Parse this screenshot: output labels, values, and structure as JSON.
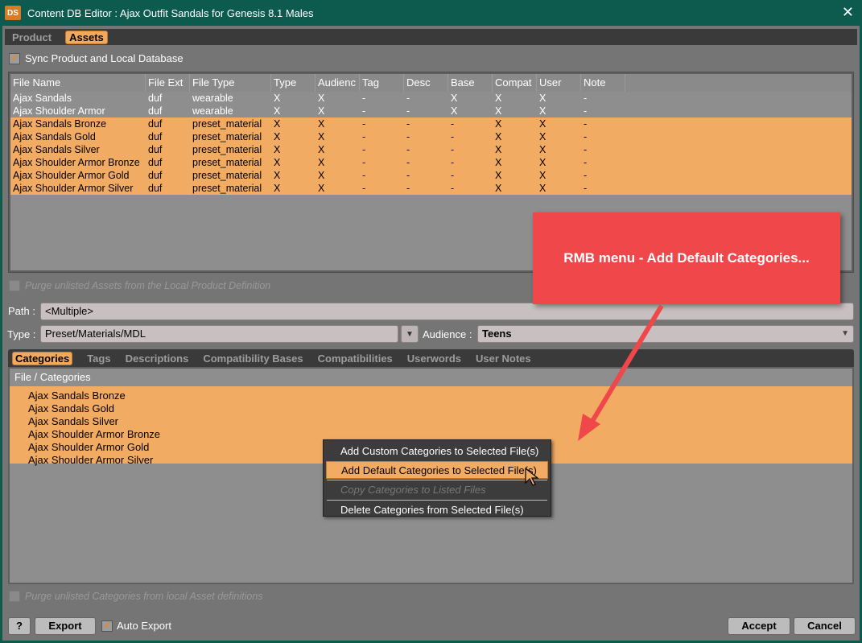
{
  "window": {
    "title": "Content DB Editor : Ajax Outfit Sandals for Genesis 8.1 Males",
    "logo": "DS",
    "close": "✕"
  },
  "top_tabs": [
    {
      "label": "Product"
    },
    {
      "label": "Assets"
    }
  ],
  "sync": {
    "label": "Sync Product and Local Database",
    "checked": true
  },
  "asset_table": {
    "columns": [
      "File Name",
      "File Ext",
      "File Type",
      "Type",
      "Audienc",
      "Tag",
      "Desc",
      "Base",
      "Compat",
      "User",
      "Note"
    ],
    "rows": [
      {
        "selected": false,
        "cells": [
          "Ajax Sandals",
          "duf",
          "wearable",
          "X",
          "X",
          "-",
          "-",
          "X",
          "X",
          "X",
          "-"
        ]
      },
      {
        "selected": false,
        "cells": [
          "Ajax Shoulder Armor",
          "duf",
          "wearable",
          "X",
          "X",
          "-",
          "-",
          "X",
          "X",
          "X",
          "-"
        ]
      },
      {
        "selected": true,
        "cells": [
          "Ajax Sandals Bronze",
          "duf",
          "preset_material",
          "X",
          "X",
          "-",
          "-",
          "-",
          "X",
          "X",
          "-"
        ]
      },
      {
        "selected": true,
        "cells": [
          "Ajax Sandals Gold",
          "duf",
          "preset_material",
          "X",
          "X",
          "-",
          "-",
          "-",
          "X",
          "X",
          "-"
        ]
      },
      {
        "selected": true,
        "cells": [
          "Ajax Sandals Silver",
          "duf",
          "preset_material",
          "X",
          "X",
          "-",
          "-",
          "-",
          "X",
          "X",
          "-"
        ]
      },
      {
        "selected": true,
        "cells": [
          "Ajax Shoulder Armor Bronze",
          "duf",
          "preset_material",
          "X",
          "X",
          "-",
          "-",
          "-",
          "X",
          "X",
          "-"
        ]
      },
      {
        "selected": true,
        "cells": [
          "Ajax Shoulder Armor Gold",
          "duf",
          "preset_material",
          "X",
          "X",
          "-",
          "-",
          "-",
          "X",
          "X",
          "-"
        ]
      },
      {
        "selected": true,
        "cells": [
          "Ajax Shoulder Armor Silver",
          "duf",
          "preset_material",
          "X",
          "X",
          "-",
          "-",
          "-",
          "X",
          "X",
          "-"
        ]
      }
    ]
  },
  "purge_assets": {
    "label": "Purge unlisted Assets from the Local Product Definition",
    "enabled": false
  },
  "path": {
    "label": "Path :",
    "value": "<Multiple>"
  },
  "type": {
    "label": "Type :",
    "value": "Preset/Materials/MDL"
  },
  "audience": {
    "label": "Audience :",
    "value": "Teens"
  },
  "bottom_tabs": [
    {
      "label": "Categories"
    },
    {
      "label": "Tags"
    },
    {
      "label": "Descriptions"
    },
    {
      "label": "Compatibility Bases"
    },
    {
      "label": "Compatibilities"
    },
    {
      "label": "Userwords"
    },
    {
      "label": "User Notes"
    }
  ],
  "categories": {
    "header": "File / Categories",
    "items": [
      {
        "label": "Ajax Sandals Bronze"
      },
      {
        "label": "Ajax Sandals Gold"
      },
      {
        "label": "Ajax Sandals Silver"
      },
      {
        "label": "Ajax Shoulder Armor Bronze"
      },
      {
        "label": "Ajax Shoulder Armor Gold"
      },
      {
        "label": "Ajax Shoulder Armor Silver"
      }
    ]
  },
  "context_menu": {
    "items": [
      {
        "label": "Add Custom Categories to Selected File(s)",
        "state": "normal"
      },
      {
        "label": "Add Default Categories to Selected File(s)",
        "state": "hover"
      },
      {
        "label": "Copy Categories to Listed Files",
        "state": "disabled"
      },
      {
        "label": "Delete Categories from Selected File(s)",
        "state": "normal"
      }
    ]
  },
  "purge_categories": {
    "label": "Purge unlisted Categories from local Asset definitions",
    "enabled": false
  },
  "footer": {
    "help": "?",
    "export": "Export",
    "auto_export": {
      "label": "Auto Export",
      "checked": true
    },
    "accept": "Accept",
    "cancel": "Cancel"
  },
  "annotation": {
    "text": "RMB menu - Add Default Categories...",
    "color": "#f0474b"
  },
  "colors": {
    "selection": "#f2ab62",
    "title_bar": "#0d5b4e",
    "panel": "#757575"
  }
}
